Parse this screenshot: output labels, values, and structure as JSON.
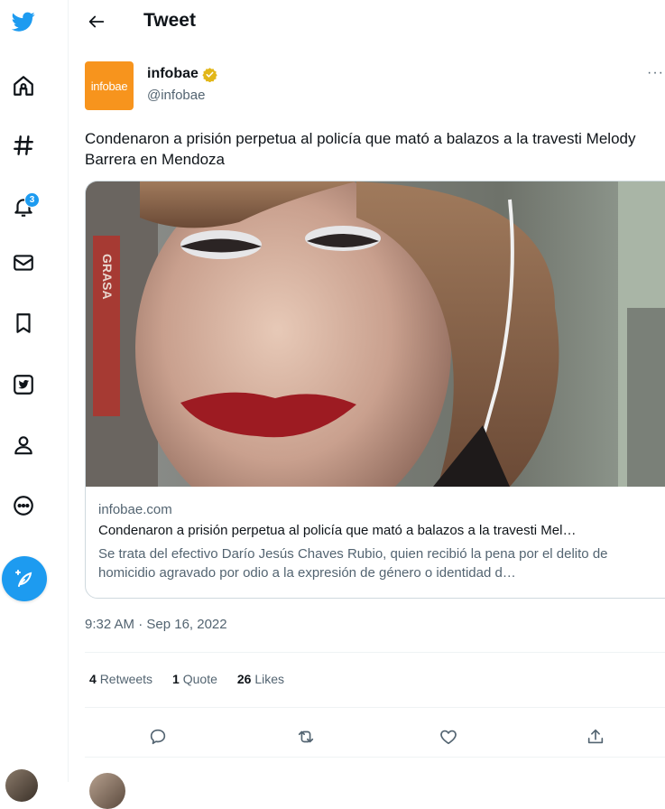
{
  "colors": {
    "accent": "#1d9bf0",
    "brand_infobae": "#f7941d",
    "verified_gold": "#e2b719"
  },
  "sidebar": {
    "items": [
      {
        "icon": "twitter-logo-icon"
      },
      {
        "icon": "home-icon"
      },
      {
        "icon": "explore-hashtag-icon"
      },
      {
        "icon": "notifications-bell-icon",
        "badge": "3"
      },
      {
        "icon": "messages-envelope-icon"
      },
      {
        "icon": "bookmarks-icon"
      },
      {
        "icon": "twitter-blue-icon"
      },
      {
        "icon": "profile-icon"
      },
      {
        "icon": "more-circle-icon"
      }
    ],
    "compose_icon": "compose-feather-icon"
  },
  "header": {
    "title": "Tweet",
    "back_icon": "back-arrow-icon"
  },
  "tweet": {
    "author": {
      "name": "infobae",
      "handle": "@infobae",
      "avatar_text": "infobae",
      "verified_icon": "verified-gold-badge-icon"
    },
    "more_label": "···",
    "text": "Condenaron a prisión perpetua al policía que mató a balazos a la travesti Melody Barrera en Mendoza",
    "card": {
      "domain": "infobae.com",
      "title": "Condenaron a prisión perpetua al policía que mató a balazos a la travesti Mel…",
      "description": "Se trata del efectivo Darío Jesús Chaves Rubio, quien recibió la pena por el delito de homicidio agravado por odio a la expresión de género o identidad d…",
      "image_sign_text": "GRASA"
    },
    "timestamp": "9:32 AM · Sep 16, 2022",
    "stats": {
      "retweets_count": "4",
      "retweets_label": "Retweets",
      "quotes_count": "1",
      "quotes_label": "Quote",
      "likes_count": "26",
      "likes_label": "Likes"
    },
    "actions": [
      "reply-icon",
      "retweet-icon",
      "like-heart-icon",
      "share-icon"
    ]
  }
}
